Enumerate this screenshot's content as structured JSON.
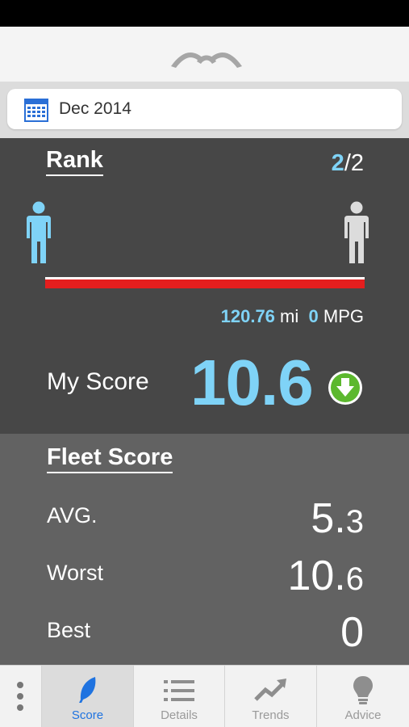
{
  "date": {
    "label": "Dec 2014"
  },
  "rank": {
    "title": "Rank",
    "position": "2",
    "total": "/2",
    "distance": "120.76",
    "distance_unit": "mi",
    "mpg": "0",
    "mpg_unit": "MPG"
  },
  "my_score": {
    "label": "My Score",
    "value": "10.6",
    "trend_icon": "arrow-down-circle-icon"
  },
  "fleet": {
    "title": "Fleet Score",
    "avg_label": "AVG.",
    "avg_int": "5.",
    "avg_dec": "3",
    "worst_label": "Worst",
    "worst_int": "10.",
    "worst_dec": "6",
    "best_label": "Best",
    "best_value": "0"
  },
  "tabs": {
    "score": "Score",
    "details": "Details",
    "trends": "Trends",
    "advice": "Advice"
  },
  "colors": {
    "accent": "#7fd3f7",
    "bar": "#e41e1e",
    "trend": "#5cb82e",
    "active_tab": "#1f73e0"
  }
}
